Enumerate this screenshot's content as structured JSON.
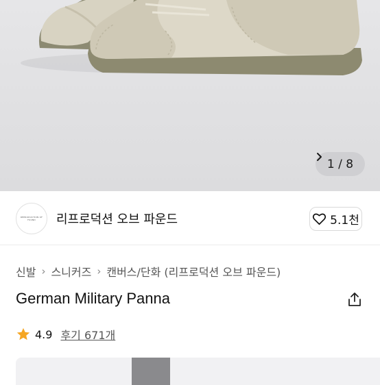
{
  "gallery": {
    "image_alt": "German Military Panna sneaker",
    "page_current": "1",
    "page_total": "8",
    "page_indicator": "1 / 8",
    "next_icon": "chevron-right-icon"
  },
  "brand": {
    "logo_text": "REPRODUCTION OF FOUND",
    "name": "리프로덕션 오브 파운드",
    "like_icon": "heart-outline-icon",
    "like_count": "5.1천"
  },
  "breadcrumb": {
    "items": [
      "신발",
      "스니커즈",
      "캔버스/단화 (리프로덕션 오브 파운드)"
    ]
  },
  "product": {
    "title": "German Military Panna",
    "share_icon": "share-icon"
  },
  "rating": {
    "star_icon": "star-icon",
    "score": "4.9",
    "reviews_label": "후기 671개",
    "star_color": "#f5a623"
  }
}
